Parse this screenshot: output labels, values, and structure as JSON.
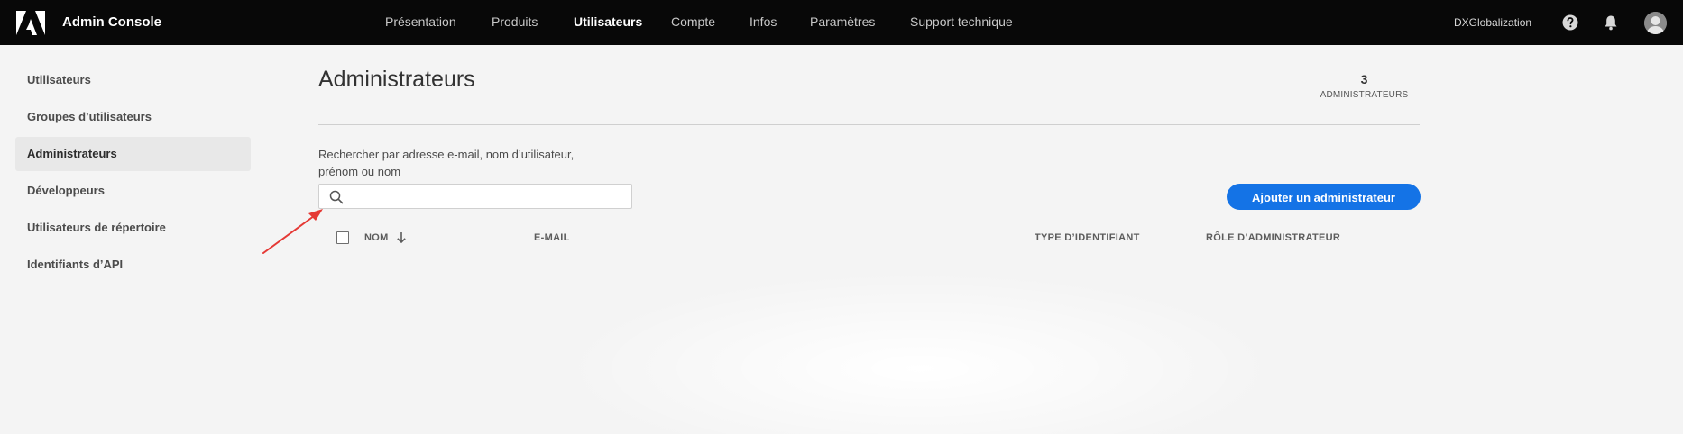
{
  "header": {
    "app_title": "Admin Console",
    "nav": [
      {
        "label": "Présentation",
        "active": false
      },
      {
        "label": "Produits",
        "active": false
      },
      {
        "label": "Utilisateurs",
        "active": true
      },
      {
        "label": "Compte",
        "active": false
      },
      {
        "label": "Infos",
        "active": false
      },
      {
        "label": "Paramètres",
        "active": false
      },
      {
        "label": "Support technique",
        "active": false
      }
    ],
    "org_name": "DXGlobalization",
    "icons": [
      "help-icon",
      "bell-icon",
      "avatar"
    ]
  },
  "sidebar": {
    "items": [
      {
        "label": "Utilisateurs",
        "active": false
      },
      {
        "label": "Groupes d’utilisateurs",
        "active": false
      },
      {
        "label": "Administrateurs",
        "active": true
      },
      {
        "label": "Développeurs",
        "active": false
      },
      {
        "label": "Utilisateurs de répertoire",
        "active": false
      },
      {
        "label": "Identifiants d’API",
        "active": false
      }
    ]
  },
  "main": {
    "title": "Administrateurs",
    "count_value": "3",
    "count_label": "ADMINISTRATEURS",
    "search_label": "Rechercher par adresse e-mail, nom d’utilisateur, prénom ou nom",
    "search_value": "",
    "search_placeholder": "",
    "add_button_label": "Ajouter un administrateur",
    "table_headers": {
      "name": "NOM",
      "email": "E-MAIL",
      "id_type": "TYPE D’IDENTIFIANT",
      "role": "RÔLE D’ADMINISTRATEUR"
    }
  },
  "colors": {
    "topbar_bg": "#080808",
    "accent": "#1473e6",
    "page_bg": "#f4f4f4",
    "annotation": "#e53935"
  }
}
